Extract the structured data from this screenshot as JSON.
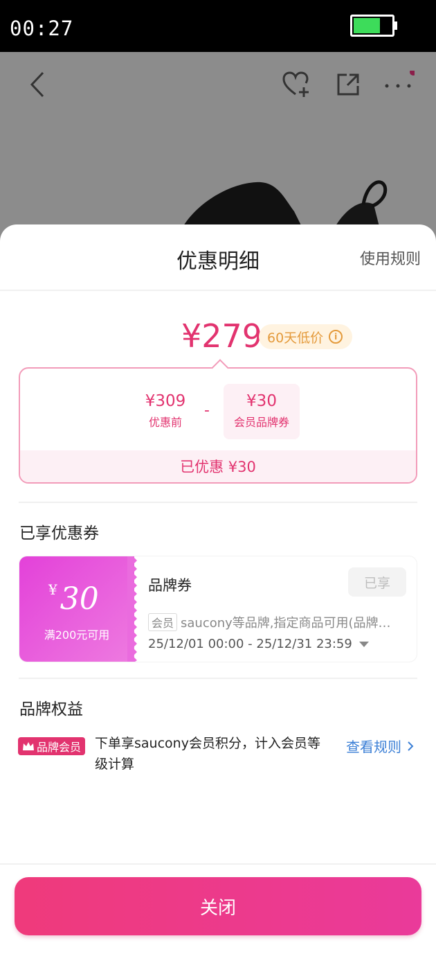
{
  "status_bar": {
    "time": "00:27",
    "battery_level": 0.7
  },
  "sheet": {
    "title": "优惠明细",
    "rules_link": "使用规则",
    "final_price": "¥279",
    "low_price_badge": "60天低价",
    "breakdown": {
      "original_value": "¥309",
      "original_label": "优惠前",
      "operator": "-",
      "discount_value": "¥30",
      "discount_label": "会员品牌券",
      "saved_text": "已优惠 ¥30"
    },
    "coupons_section_title": "已享优惠券",
    "coupon": {
      "currency": "¥",
      "amount": "30",
      "condition": "满200元可用",
      "name": "品牌券",
      "status_button": "已享",
      "tag": "会员",
      "description": "saucony等品牌,指定商品可用(品牌…",
      "validity": "25/12/01 00:00 - 25/12/31 23:59"
    },
    "benefits_section_title": "品牌权益",
    "benefit": {
      "badge": "品牌会员",
      "text": "下单享saucony会员积分，计入会员等级计算",
      "link": "查看规则"
    },
    "close_button": "关闭"
  },
  "colors": {
    "accent": "#e2336f",
    "coupon_gradient_start": "#e341d9",
    "link": "#3b7fd6"
  }
}
